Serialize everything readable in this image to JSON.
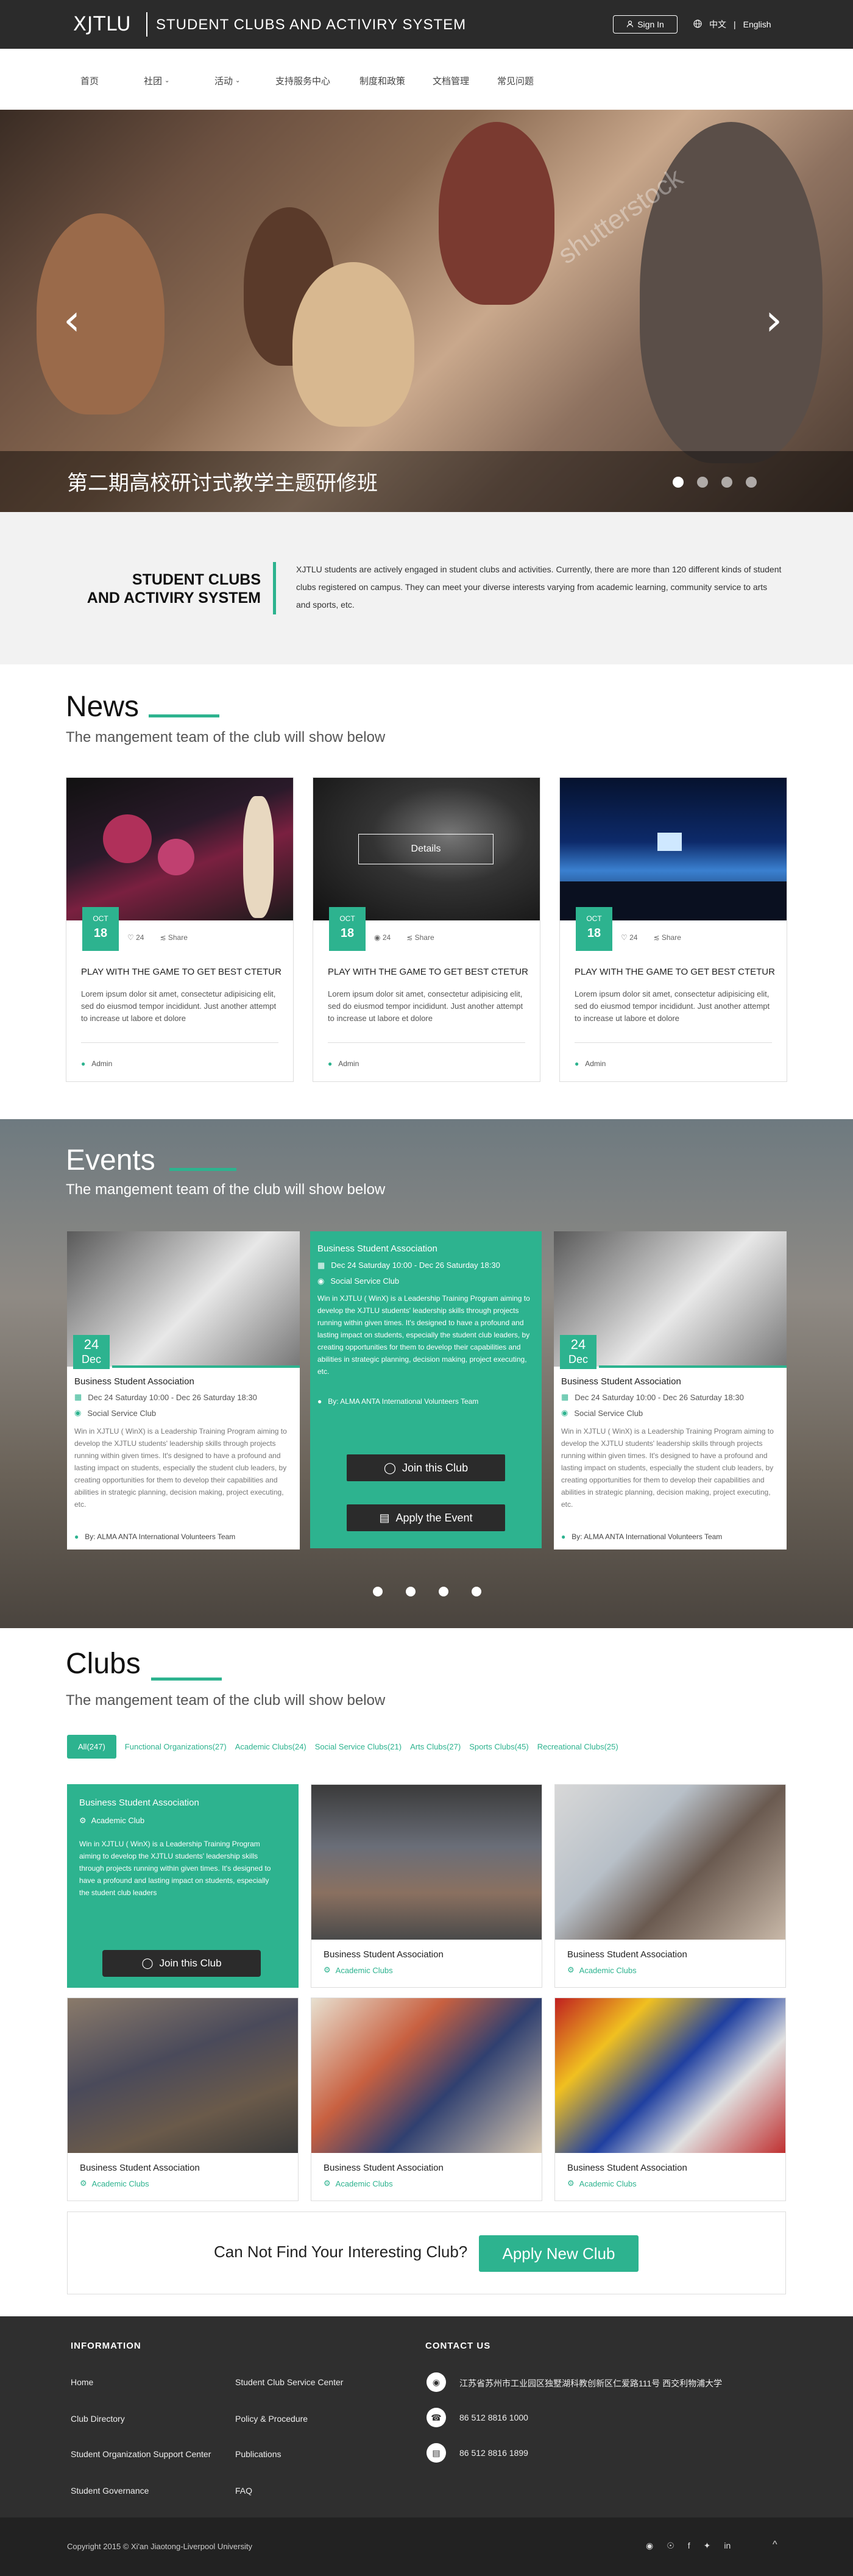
{
  "header": {
    "logo": "XJTLU",
    "title": "STUDENT CLUBS AND ACTIVIRY SYSTEM",
    "signin": "Sign In",
    "lang_zh": "中文",
    "lang_sep": "|",
    "lang_en": "English"
  },
  "nav": [
    {
      "label": "首页",
      "dropdown": false
    },
    {
      "label": "社团",
      "dropdown": true
    },
    {
      "label": "活动",
      "dropdown": true
    },
    {
      "label": "支持服务中心",
      "dropdown": false
    },
    {
      "label": "制度和政策",
      "dropdown": false
    },
    {
      "label": "文档管理",
      "dropdown": false
    },
    {
      "label": "常见问题",
      "dropdown": false
    }
  ],
  "hero": {
    "caption": "第二期高校研讨式教学主题研修班",
    "watermark": "shutterstock",
    "active_slide": 1,
    "slide_count": 4
  },
  "intro": {
    "title_line1": "STUDENT CLUBS",
    "title_line2": "AND ACTIVIRY SYSTEM",
    "text": "XJTLU students are actively engaged in student clubs and activities. Currently, there are more than 120 different kinds of student clubs registered on campus. They can meet your diverse interests varying from academic learning, community service to arts and sports, etc."
  },
  "news": {
    "title": "News",
    "subtitle": "The mangement team of the club will show below",
    "details_label": "Details",
    "cards": [
      {
        "month": "OCT",
        "day": "18",
        "likes": "24",
        "share": "Share",
        "title": "PLAY WITH THE GAME TO GET BEST CTETUR",
        "desc": "Lorem ipsum dolor sit amet, consectetur adipisicing elit, sed do eiusmod tempor incididunt. Just another attempt to increase ut labore et dolore",
        "author": "Admin"
      },
      {
        "month": "OCT",
        "day": "18",
        "likes": "24",
        "share": "Share",
        "title": "PLAY WITH THE GAME TO GET BEST CTETUR",
        "desc": "Lorem ipsum dolor sit amet, consectetur adipisicing elit, sed do eiusmod tempor incididunt. Just another attempt to increase ut labore et dolore",
        "author": "Admin"
      },
      {
        "month": "OCT",
        "day": "18",
        "likes": "24",
        "share": "Share",
        "title": "PLAY WITH THE GAME TO GET BEST CTETUR",
        "desc": "Lorem ipsum dolor sit amet, consectetur adipisicing elit, sed do eiusmod tempor incididunt. Just another attempt to increase ut labore et dolore",
        "author": "Admin"
      }
    ]
  },
  "events": {
    "title": "Events",
    "subtitle": "The mangement team of the club will show below",
    "cards": [
      {
        "day": "24",
        "month": "Dec",
        "title": "Business Student Association",
        "time": "Dec 24 Saturday 10:00 - Dec 26 Saturday 18:30",
        "club": "Social Service Club",
        "desc": "Win in XJTLU ( WinX) is a Leadership Training Program aiming to develop the XJTLU students' leadership skills through projects running within given times. It's designed to have a profound and lasting impact on students, especially the student club leaders, by creating opportunities for them to develop their capabilities and abilities in strategic planning, decision making, project executing, etc.",
        "team": "By: ALMA ANTA International Volunteers Team"
      },
      {
        "title": "Business Student Association",
        "time": "Dec 24 Saturday 10:00 - Dec 26 Saturday 18:30",
        "club": "Social Service Club",
        "desc": "Win in XJTLU ( WinX) is a Leadership Training Program aiming to develop the XJTLU students' leadership skills through projects running within given times. It's designed to have a profound and lasting impact on students, especially the student club leaders, by creating opportunities for them to develop their capabilities and abilities in strategic planning, decision making, project executing, etc.",
        "team": "By: ALMA ANTA International Volunteers Team",
        "join_label": "Join this Club",
        "apply_label": "Apply the Event"
      },
      {
        "day": "24",
        "month": "Dec",
        "title": "Business Student Association",
        "time": "Dec 24 Saturday 10:00 - Dec 26 Saturday 18:30",
        "club": "Social Service Club",
        "desc": "Win in XJTLU ( WinX) is a Leadership Training Program aiming to develop the XJTLU students' leadership skills through projects running within given times. It's designed to have a profound and lasting impact on students, especially the student club leaders, by creating opportunities for them to develop their capabilities and abilities in strategic planning, decision making, project executing, etc.",
        "team": "By: ALMA ANTA International Volunteers Team"
      }
    ],
    "active_dot": 0,
    "dot_count": 4
  },
  "clubs": {
    "title": "Clubs",
    "subtitle": "The mangement team of the club will show below",
    "tabs": [
      "All(247)",
      "Functional Organizations(27)",
      "Academic Clubs(24)",
      "Social Service Clubs(21)",
      "Arts Clubs(27)",
      "Sports Clubs(45)",
      "Recreational Clubs(25)"
    ],
    "feature": {
      "name": "Business Student Association",
      "category": "Academic Club",
      "desc": "Win in XJTLU ( WinX) is a Leadership Training Program aiming to develop the XJTLU students' leadership skills through projects running within given times. It's designed to have a profound and lasting impact on students, especially the student club leaders",
      "join_label": "Join this Club"
    },
    "cards": [
      {
        "name": "Business Student Association",
        "category": "Academic Clubs"
      },
      {
        "name": "Business Student Association",
        "category": "Academic Clubs"
      },
      {
        "name": "Business Student Association",
        "category": "Academic Clubs"
      },
      {
        "name": "Business Student Association",
        "category": "Academic Clubs"
      },
      {
        "name": "Business Student Association",
        "category": "Academic Clubs"
      }
    ]
  },
  "cta": {
    "text": "Can Not Find Your Interesting Club?",
    "button": "Apply New Club"
  },
  "footer": {
    "info_heading": "INFORMATION",
    "contact_heading": "CONTACT US",
    "links_col1": [
      "Home",
      "Club Directory",
      "Student Organization Support Center",
      "Student Governance"
    ],
    "links_col2": [
      "Student Club Service Center",
      "Policy & Procedure",
      "Publications",
      "FAQ"
    ],
    "address": "江苏省苏州市工业园区独墅湖科教创新区仁爱路111号  西交利物浦大学",
    "phone": "86 512 8816 1000",
    "fax": "86 512 8816 1899",
    "copyright": "Copyright 2015 © Xi'an Jiaotong-Liverpool University",
    "to_top": "^"
  },
  "colors": {
    "accent": "#2db38f",
    "header": "#2b2b2b",
    "footer": "#2f2f2f"
  }
}
